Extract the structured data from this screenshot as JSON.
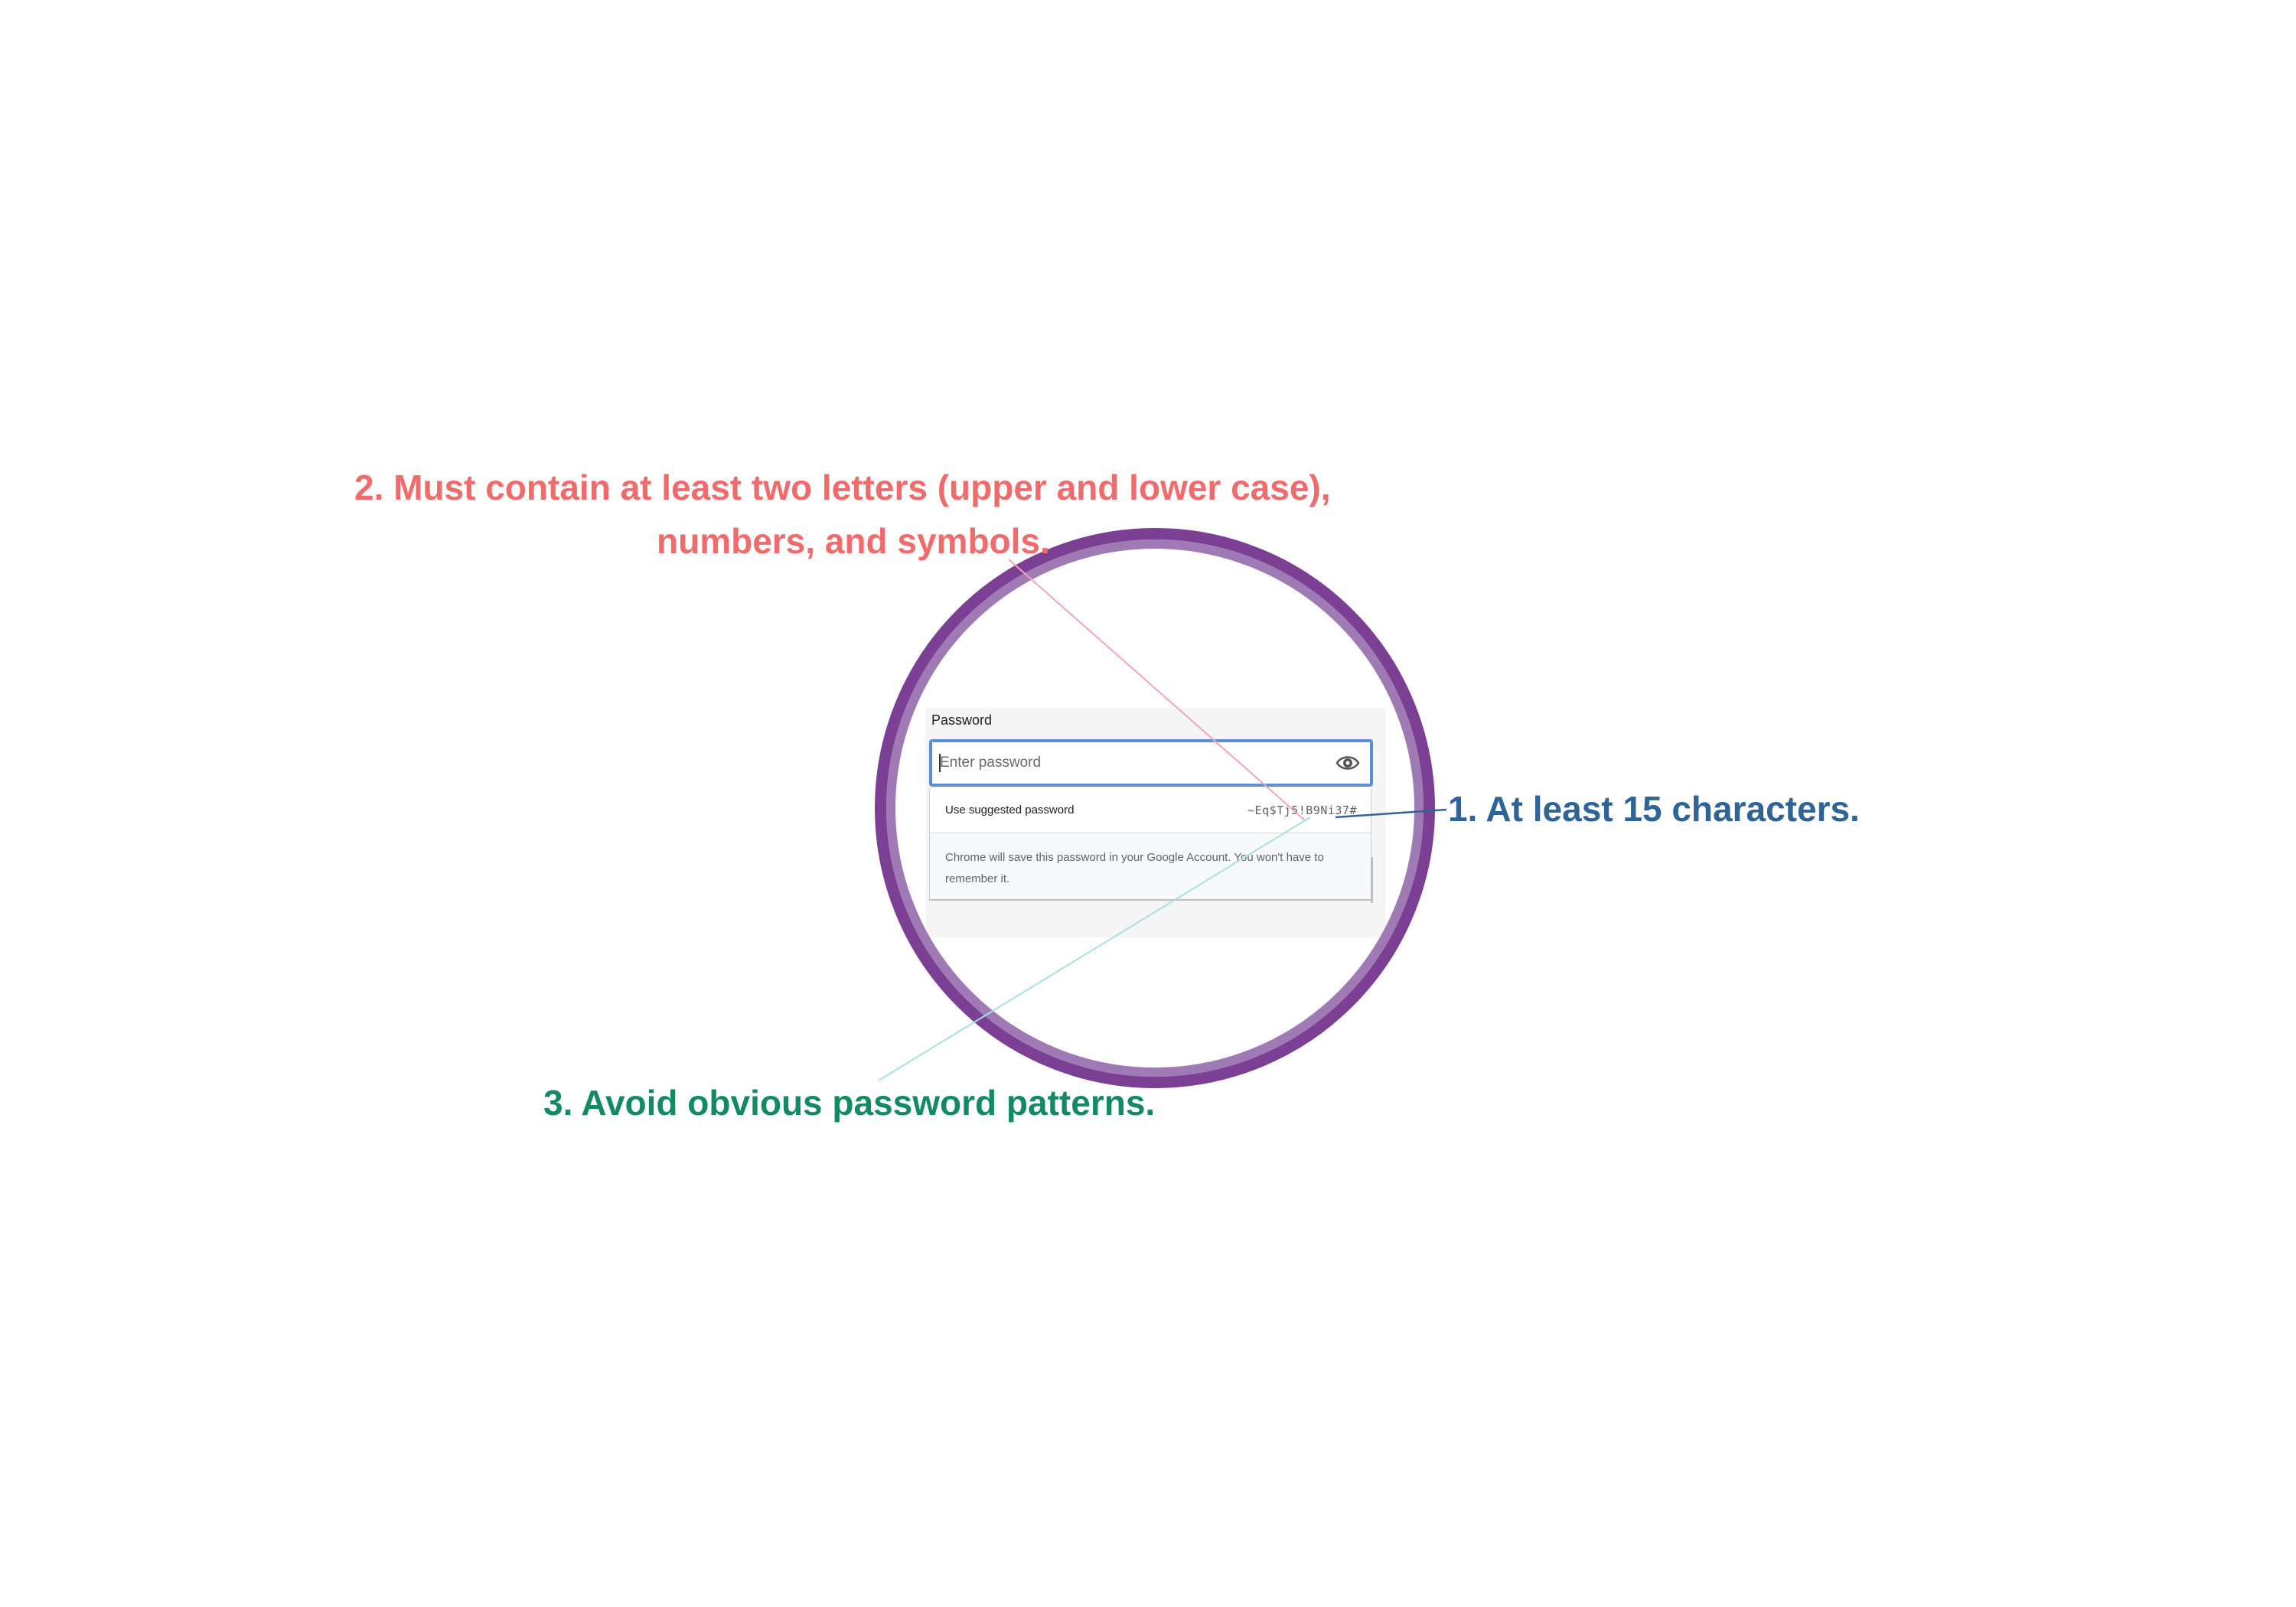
{
  "colors": {
    "lens_ring_outer": "#7b3f94",
    "lens_ring_inner": "#a07ab5",
    "callout_1": "#2e6496",
    "callout_2": "#f06b6b",
    "callout_3": "#148a64",
    "leader_1": "#2e6496",
    "leader_2": "#f3a6b6",
    "leader_3": "#a8e0e2",
    "input_border": "#5a8fd6"
  },
  "magnified_ui": {
    "field_label": "Password",
    "input_placeholder": "Enter password",
    "eye_icon": "eye-icon",
    "suggestion": {
      "label": "Use suggested password",
      "value": "~Eq$Tj5!B9Ni37#"
    },
    "save_note": "Chrome will save this password in your Google Account. You won't have to remember it."
  },
  "callouts": {
    "tip_1": "1. At least 15 characters.",
    "tip_2_line1": "2. Must contain at least two letters (upper and lower case),",
    "tip_2_line2": "numbers, and symbols.",
    "tip_3": "3. Avoid obvious password patterns."
  }
}
